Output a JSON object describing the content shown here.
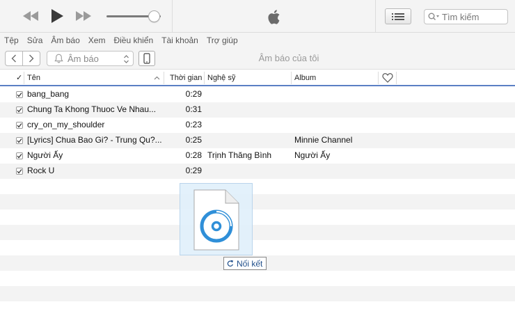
{
  "menu": [
    "Tệp",
    "Sửa",
    "Âm báo",
    "Xem",
    "Điều khiển",
    "Tài khoản",
    "Trợ giúp"
  ],
  "toolbar": {
    "prev_icon": "rewind-icon",
    "play_icon": "play-icon",
    "next_icon": "fast-forward-icon",
    "volume_level": 0.88,
    "logo_icon": "apple-logo-icon",
    "list_icon": "list-view-icon"
  },
  "search": {
    "placeholder": "Tìm kiếm"
  },
  "nav": {
    "source_label": "Âm báo",
    "title": "Âm báo của tôi"
  },
  "table": {
    "headers": {
      "check": "✓",
      "name": "Tên",
      "time": "Thời gian",
      "artist": "Nghệ sỹ",
      "album": "Album",
      "love_icon": "heart-icon"
    },
    "rows": [
      {
        "checked": true,
        "name": "bang_bang",
        "time": "0:29",
        "artist": "",
        "album": ""
      },
      {
        "checked": true,
        "name": "Chung Ta Khong Thuoc Ve Nhau...",
        "time": "0:31",
        "artist": "",
        "album": ""
      },
      {
        "checked": true,
        "name": "cry_on_my_shoulder",
        "time": "0:23",
        "artist": "",
        "album": ""
      },
      {
        "checked": true,
        "name": "[Lyrics] Chua Bao Gi? - Trung Qu?...",
        "time": "0:25",
        "artist": "",
        "album": "Minnie Channel"
      },
      {
        "checked": true,
        "name": "Người Ấy",
        "time": "0:28",
        "artist": "Trịnh Thăng Bình",
        "album": "Người Ấy"
      },
      {
        "checked": true,
        "name": "Rock U",
        "time": "0:29",
        "artist": "",
        "album": ""
      }
    ]
  },
  "drag": {
    "file_icon": "audio-file-icon",
    "tooltip": "Nối kết",
    "tooltip_icon": "link-arrow-icon"
  },
  "colors": {
    "accent": "#5a7fc4",
    "file_icon_blue": "#2f8fd8"
  }
}
